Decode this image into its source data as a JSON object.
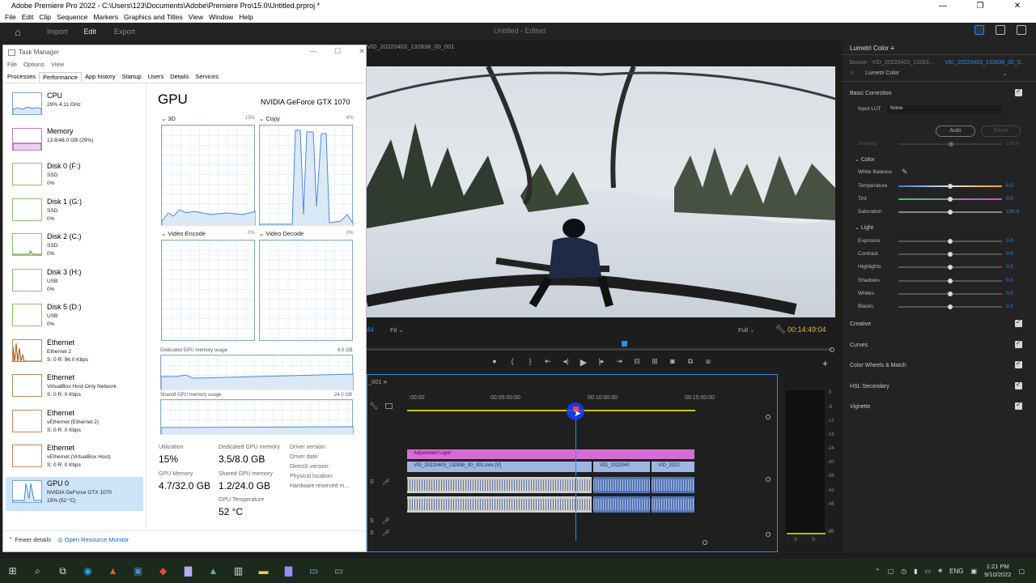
{
  "premiere": {
    "window_title": "Adobe Premiere Pro 2022 - C:\\Users\\123\\Documents\\Adobe\\Premiere Pro\\15.0\\Untitled.prproj *",
    "menus": [
      "File",
      "Edit",
      "Clip",
      "Sequence",
      "Markers",
      "Graphics and Titles",
      "View",
      "Window",
      "Help"
    ],
    "workspaces": [
      "Import",
      "Edit",
      "Export"
    ],
    "project_title": "Untitled - Edited",
    "program_tab": "VID_20220403_132838_00_001",
    "fit": "Fit",
    "quality": "Full",
    "timecode": "00:14:49:04",
    "timecode_left": "44",
    "sequence_tab": "_001",
    "ruler_ticks": [
      ":00:00",
      "00:05:00:00",
      "00:10:00:00",
      "00:15:00:00"
    ],
    "clips": {
      "adjustment": "Adjustment Layer",
      "v1a": "VID_20220403_132838_00_001.insv [V]",
      "v1b": "VID_2022040",
      "v1c": "VID_2022"
    },
    "meter_labels": [
      "0",
      "-6",
      "-12",
      "-18",
      "-24",
      "-30",
      "-36",
      "-42",
      "-48",
      "dB"
    ],
    "meter_solo": [
      "S",
      "S"
    ]
  },
  "lumetri": {
    "tab": "Lumetri Color",
    "source": "Source - VID_20220403_13283...",
    "source_clip": "VID_20220403_132838_00_0...",
    "fx": "Lumetri Color",
    "basic": "Basic Correction",
    "input_lut_label": "Input LUT",
    "input_lut_value": "None",
    "auto": "Auto",
    "reset": "Reset",
    "intensity_label": "Intensity",
    "intensity_value": "100.0",
    "color_section": "Color",
    "white_balance": "White Balance",
    "color_rows": [
      {
        "label": "Temperature",
        "value": "0.0",
        "pos": 0.5
      },
      {
        "label": "Tint",
        "value": "0.0",
        "pos": 0.5
      },
      {
        "label": "Saturation",
        "value": "100.0",
        "pos": 0.5
      }
    ],
    "light_section": "Light",
    "light_rows": [
      {
        "label": "Exposure",
        "value": "0.0",
        "pos": 0.5
      },
      {
        "label": "Contrast",
        "value": "0.0",
        "pos": 0.5
      },
      {
        "label": "Highlights",
        "value": "0.0",
        "pos": 0.5
      },
      {
        "label": "Shadows",
        "value": "0.0",
        "pos": 0.5
      },
      {
        "label": "Whites",
        "value": "0.0",
        "pos": 0.5
      },
      {
        "label": "Blacks",
        "value": "0.0",
        "pos": 0.5
      }
    ],
    "sections": [
      "Creative",
      "Curves",
      "Color Wheels & Match",
      "HSL Secondary",
      "Vignette"
    ]
  },
  "taskmgr": {
    "title": "Task Manager",
    "menu": [
      "File",
      "Options",
      "View"
    ],
    "tabs": [
      "Processes",
      "Performance",
      "App history",
      "Startup",
      "Users",
      "Details",
      "Services"
    ],
    "resources": [
      {
        "name": "CPU",
        "s1": "29%  4.11 GHz",
        "s2": ""
      },
      {
        "name": "Memory",
        "s1": "13.8/48.0 GB (29%)",
        "s2": ""
      },
      {
        "name": "Disk 0 (F:)",
        "s1": "SSD",
        "s2": "0%"
      },
      {
        "name": "Disk 1 (G:)",
        "s1": "SSD",
        "s2": "0%"
      },
      {
        "name": "Disk 2 (C:)",
        "s1": "SSD",
        "s2": "0%"
      },
      {
        "name": "Disk 3 (H:)",
        "s1": "USB",
        "s2": "0%"
      },
      {
        "name": "Disk 5 (D:)",
        "s1": "USB",
        "s2": "0%"
      },
      {
        "name": "Ethernet",
        "s1": "Ethernet 2",
        "s2": "S: 0 R: 96.0 Kbps"
      },
      {
        "name": "Ethernet",
        "s1": "VirtualBox Host-Only Network",
        "s2": "S: 0 R: 0 Kbps"
      },
      {
        "name": "Ethernet",
        "s1": "vEthernet (Ethernet 2)",
        "s2": "S: 0 R: 0 Kbps"
      },
      {
        "name": "Ethernet",
        "s1": "vEthernet (VirtualBox Host)",
        "s2": "S: 0 R: 0 Kbps"
      },
      {
        "name": "GPU 0",
        "s1": "NVIDIA GeForce GTX 1070",
        "s2": "15% (52 °C)"
      }
    ],
    "gpu_title": "GPU",
    "gpu_name": "NVIDIA GeForce GTX 1070",
    "graphs": [
      {
        "label": "3D",
        "pct": "15%"
      },
      {
        "label": "Copy",
        "pct": "6%"
      },
      {
        "label": "Video Encode",
        "pct": "0%"
      },
      {
        "label": "Video Decode",
        "pct": "0%"
      }
    ],
    "dedicated_label": "Dedicated GPU memory usage",
    "dedicated_max": "8.0 GB",
    "shared_label": "Shared GPU memory usage",
    "shared_max": "24.0 GB",
    "stats": {
      "utilization_k": "Utilization",
      "utilization_v": "15%",
      "dedicated_k": "Dedicated GPU memory",
      "dedicated_v": "3.5/8.0 GB",
      "gpumem_k": "GPU Memory",
      "gpumem_v": "4.7/32.0 GB",
      "shared_k": "Shared GPU memory",
      "shared_v": "1.2/24.0 GB",
      "temp_k": "GPU Temperature",
      "temp_v": "52 °C",
      "driver_version": "Driver version:",
      "driver_date": "Driver date:",
      "directx": "DirectX version:",
      "physical": "Physical location:",
      "reserved": "Hardware reserved m..."
    },
    "fewer": "Fewer details",
    "open_rm": "Open Resource Monitor"
  },
  "taskbar": {
    "lang": "ENG",
    "time": "1:21 PM",
    "date": "9/10/2022"
  }
}
